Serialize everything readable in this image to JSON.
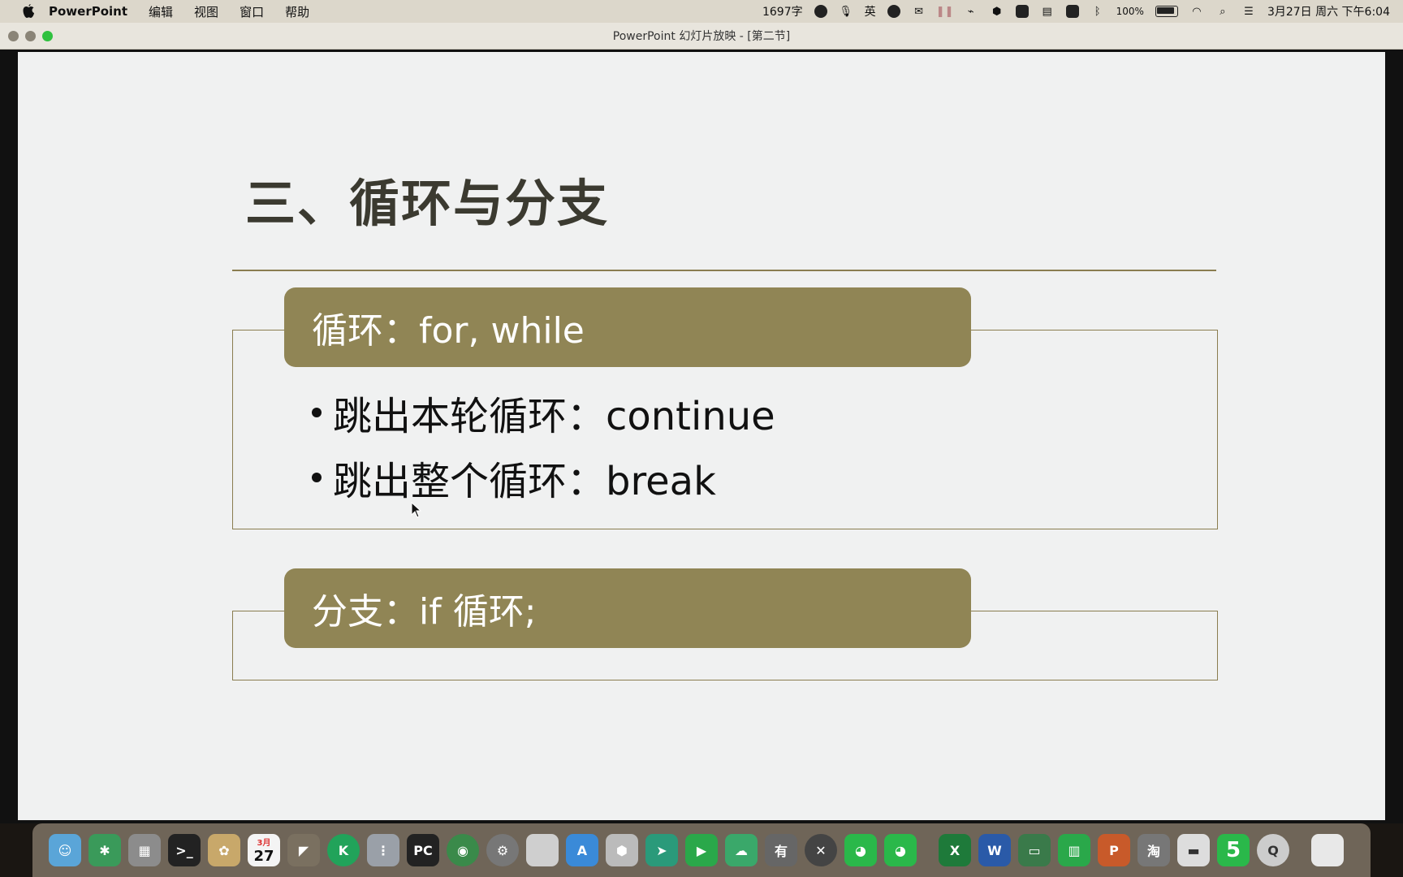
{
  "menubar": {
    "app_name": "PowerPoint",
    "items": [
      "编辑",
      "视图",
      "窗口",
      "帮助"
    ],
    "word_count": "1697字",
    "input_method": "英",
    "battery": "100%",
    "datetime": "3月27日 周六 下午6:04"
  },
  "window": {
    "title": "PowerPoint 幻灯片放映 - [第二节]"
  },
  "slide": {
    "title": "三、循环与分支",
    "loop_header": "循环：for, while",
    "bullets": [
      "跳出本轮循环：continue",
      "跳出整个循环：break"
    ],
    "branch_header": "分支：if 循环;"
  },
  "dock": {
    "calendar_month": "3月",
    "calendar_day": "27",
    "icons": [
      "finder",
      "mindmap",
      "launchpad",
      "terminal",
      "photos",
      "calendar",
      "preview",
      "kugou",
      "notes",
      "pycharm",
      "chrome",
      "system-preferences",
      "folder",
      "app-store",
      "hexagon",
      "feishu",
      "tencent-video",
      "baidu-netdisk",
      "youdao",
      "teamviewer",
      "wechat",
      "wechat-work",
      "excel",
      "word",
      "keynote",
      "numbers",
      "powerpoint",
      "taobao",
      "disk",
      "5",
      "quicktime",
      "trash"
    ]
  },
  "colors": {
    "accent": "#908555",
    "rule": "#8a7d50",
    "slide_bg": "#f0f1f1",
    "title_text": "#3b3a30"
  }
}
